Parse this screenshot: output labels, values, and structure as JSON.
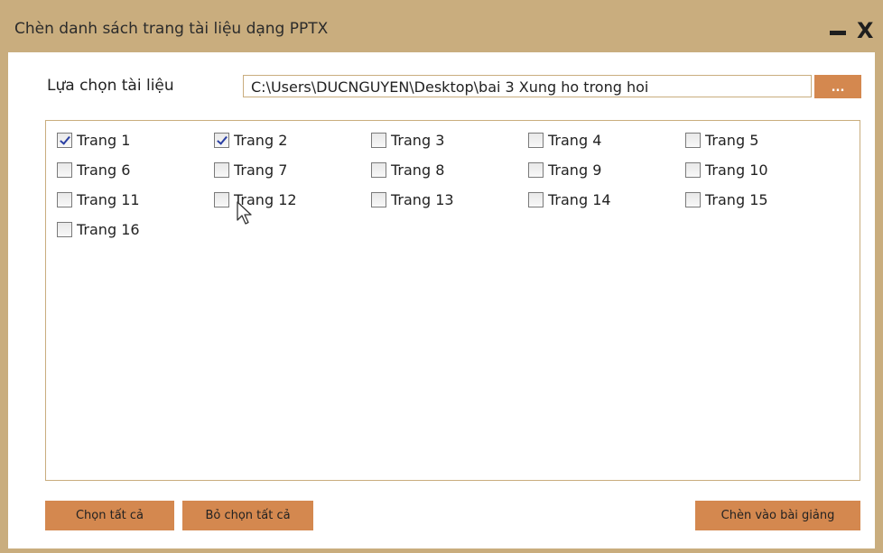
{
  "window": {
    "title": "Chèn danh sách trang tài liệu dạng PPTX",
    "minimize_label": "–",
    "close_label": "X"
  },
  "file_select": {
    "label": "Lựa chọn tài liệu",
    "path_value": "C:\\Users\\DUCNGUYEN\\Desktop\\bai 3 Xung ho trong hoi",
    "browse_label": "..."
  },
  "pages": [
    {
      "label": "Trang 1",
      "checked": true
    },
    {
      "label": "Trang 2",
      "checked": true
    },
    {
      "label": "Trang 3",
      "checked": false
    },
    {
      "label": "Trang 4",
      "checked": false
    },
    {
      "label": "Trang 5",
      "checked": false
    },
    {
      "label": "Trang 6",
      "checked": false
    },
    {
      "label": "Trang 7",
      "checked": false
    },
    {
      "label": "Trang 8",
      "checked": false
    },
    {
      "label": "Trang 9",
      "checked": false
    },
    {
      "label": "Trang 10",
      "checked": false
    },
    {
      "label": "Trang 11",
      "checked": false
    },
    {
      "label": "Trang 12",
      "checked": false
    },
    {
      "label": "Trang 13",
      "checked": false
    },
    {
      "label": "Trang 14",
      "checked": false
    },
    {
      "label": "Trang 15",
      "checked": false
    },
    {
      "label": "Trang 16",
      "checked": false
    }
  ],
  "actions": {
    "select_all": "Chọn tất cả",
    "deselect_all": "Bỏ chọn tất cả",
    "insert": "Chèn vào bài giảng"
  },
  "colors": {
    "frame": "#c9ad7e",
    "button": "#d4884f",
    "check": "#2a3fa3"
  },
  "icons": {
    "cursor": "mouse-pointer-icon"
  }
}
